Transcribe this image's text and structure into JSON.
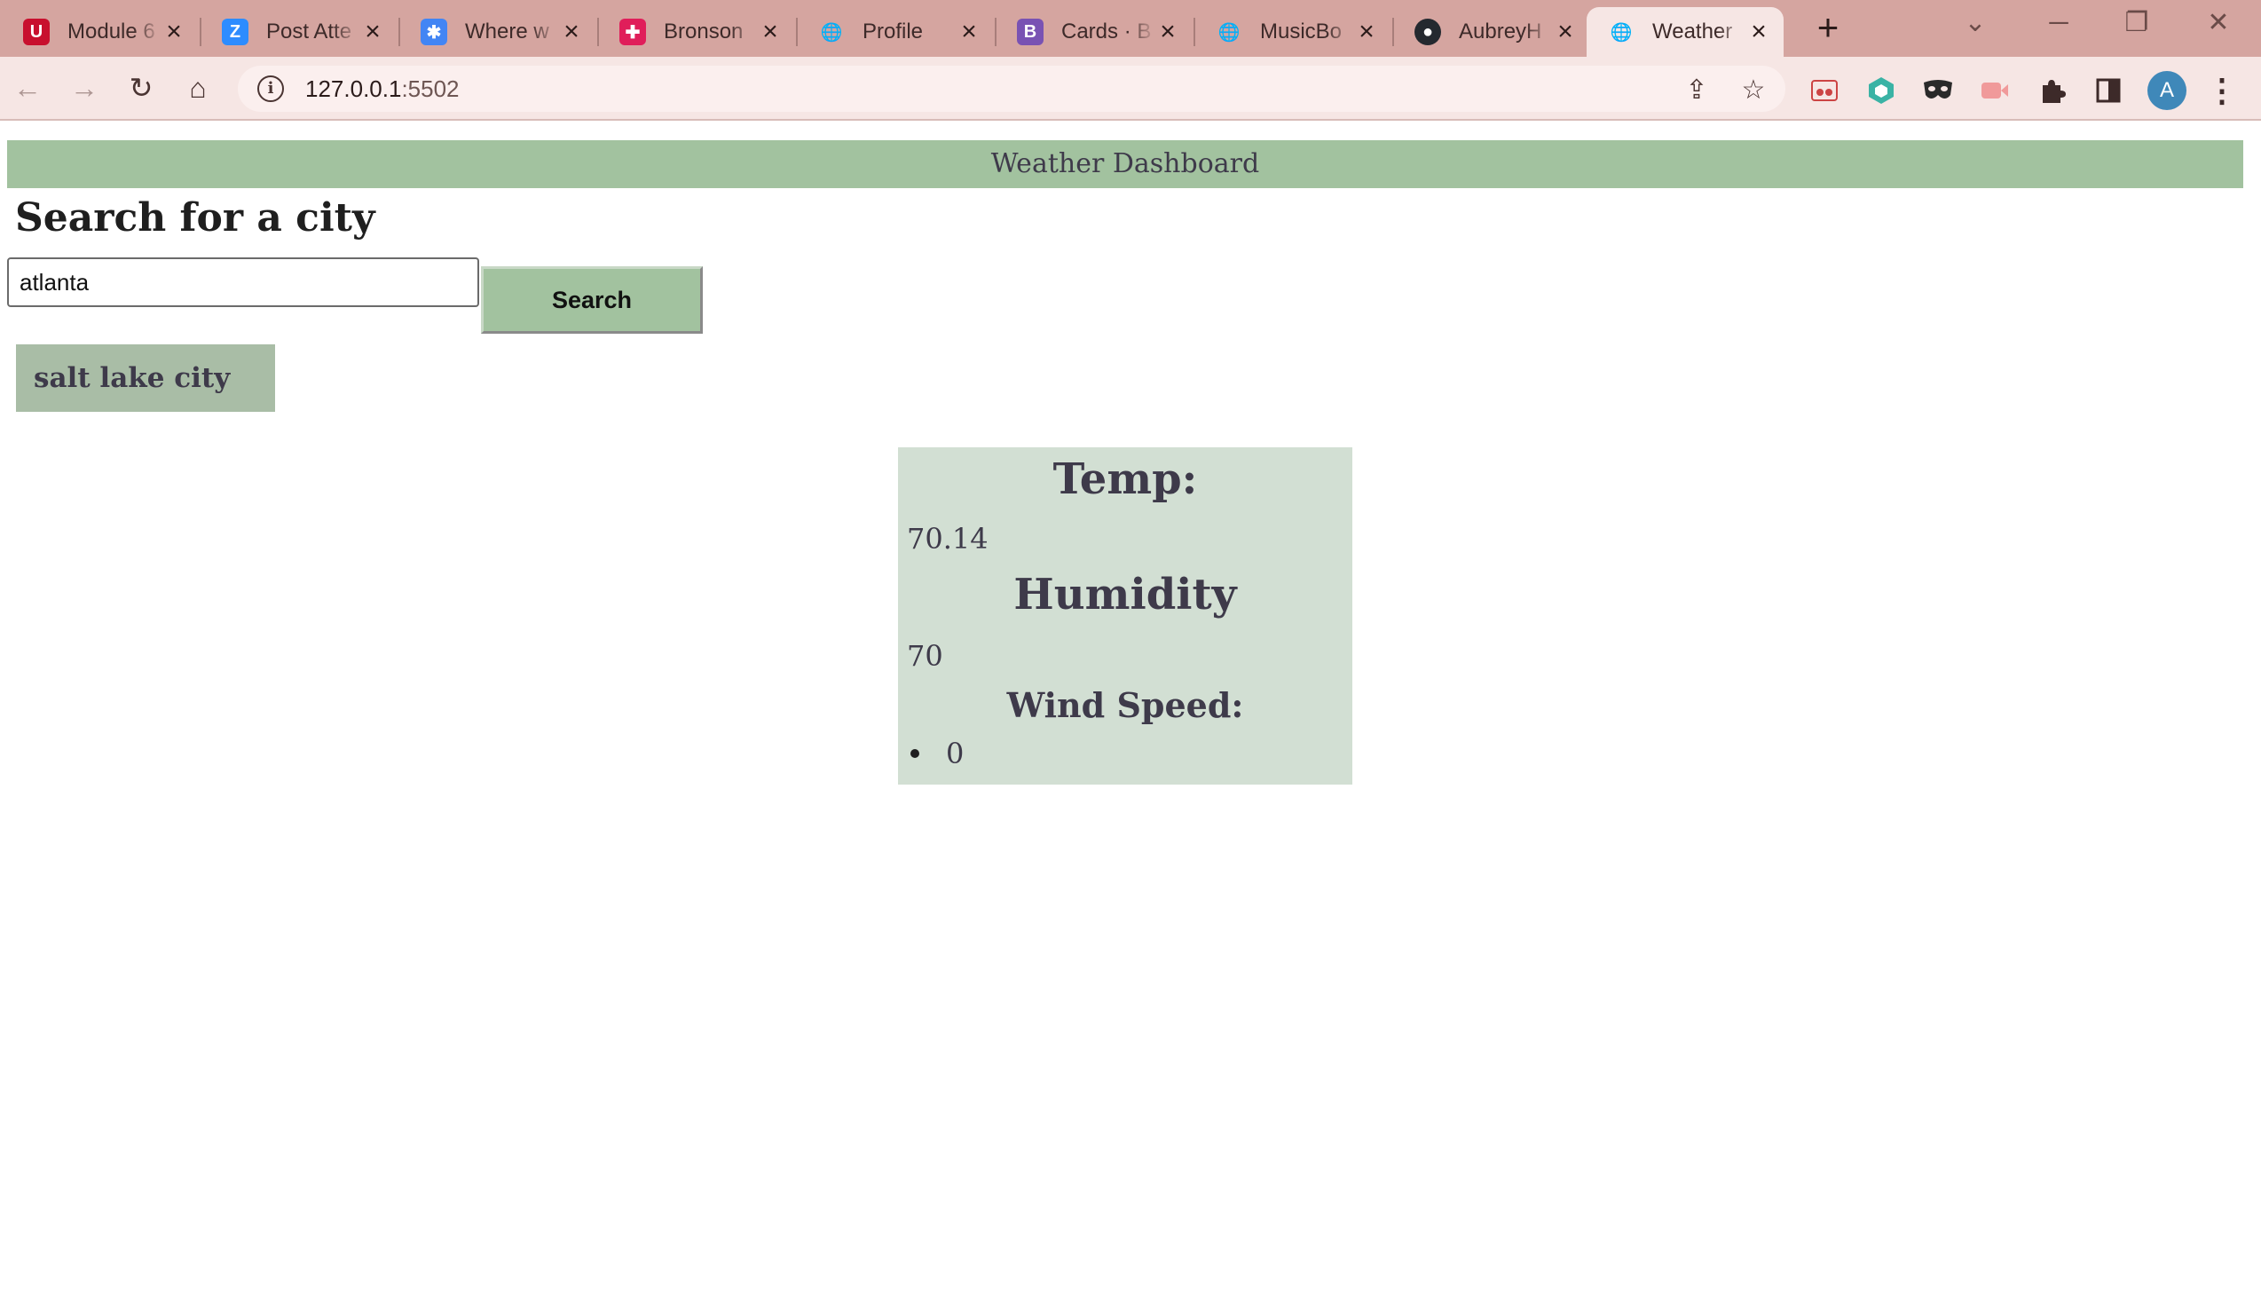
{
  "browser": {
    "tabs": [
      {
        "title": "Module 6",
        "favicon": "university-u-icon",
        "color": "#c8102e",
        "glyph": "U",
        "active": false
      },
      {
        "title": "Post Atte",
        "favicon": "zoom-icon",
        "color": "#2d8cff",
        "glyph": "Z",
        "active": false
      },
      {
        "title": "Where w",
        "favicon": "google-workspace-icon",
        "color": "#4285f4",
        "glyph": "✱",
        "active": false
      },
      {
        "title": "Bronson",
        "favicon": "slack-icon",
        "color": "#e01e5a",
        "glyph": "✚",
        "active": false
      },
      {
        "title": "Profile",
        "favicon": "globe-icon",
        "color": "#3d2a29",
        "glyph": "🌐",
        "active": false
      },
      {
        "title": "Cards · B",
        "favicon": "bootstrap-icon",
        "color": "#7952b3",
        "glyph": "B",
        "active": false
      },
      {
        "title": "MusicBo",
        "favicon": "globe-icon",
        "color": "#3d2a29",
        "glyph": "🌐",
        "active": false
      },
      {
        "title": "AubreyH",
        "favicon": "github-icon",
        "color": "#24292f",
        "glyph": "●",
        "active": false
      },
      {
        "title": "Weather",
        "favicon": "globe-icon",
        "color": "#3d2a29",
        "glyph": "🌐",
        "active": true
      }
    ],
    "new_tab": "+",
    "url_host": "127.0.0.1",
    "url_port": ":5502",
    "profile_initial": "A"
  },
  "app": {
    "header": "Weather Dashboard",
    "search_heading": "Search for a city",
    "search_value": "atlanta",
    "search_button": "Search",
    "history": [
      "salt lake city"
    ],
    "weather": {
      "temp_label": "Temp:",
      "temp_value": "70.14",
      "humidity_label": "Humidity",
      "humidity_value": "70",
      "wind_label": "Wind Speed:",
      "wind_value": "0"
    }
  },
  "colors": {
    "tabbar": "#d5a5a0",
    "header_bg": "#a2c29f",
    "card_bg": "#d2dfd3",
    "text": "#3e3a4a"
  }
}
